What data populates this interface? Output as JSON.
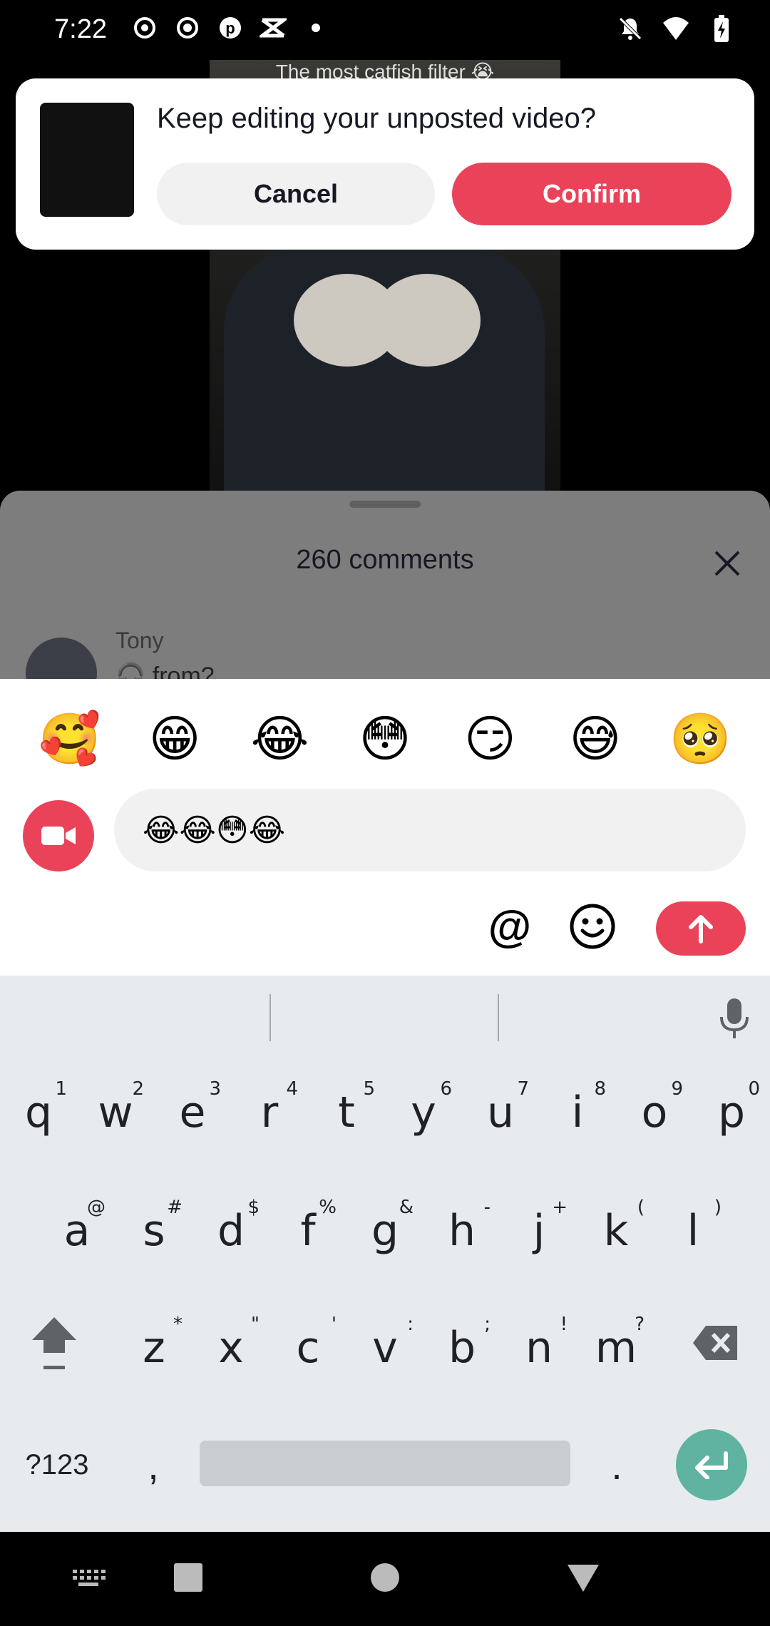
{
  "status_bar": {
    "time": "7:22"
  },
  "video": {
    "caption": "The most catfish filter 😭"
  },
  "dialog": {
    "title": "Keep editing your unposted video?",
    "cancel_label": "Cancel",
    "confirm_label": "Confirm",
    "confirm_color": "#ea4359"
  },
  "comments": {
    "title": "260 comments",
    "first_comment": {
      "user": "Tony",
      "text": "🎧 from?"
    }
  },
  "composer": {
    "quick_emojis": [
      "🥰",
      "😁",
      "😂",
      "😳",
      "😏",
      "😅",
      "🥺"
    ],
    "input_value": "😂😂😳😂",
    "at_label": "@"
  },
  "keyboard": {
    "row1": [
      {
        "k": "q",
        "h": "1"
      },
      {
        "k": "w",
        "h": "2"
      },
      {
        "k": "e",
        "h": "3"
      },
      {
        "k": "r",
        "h": "4"
      },
      {
        "k": "t",
        "h": "5"
      },
      {
        "k": "y",
        "h": "6"
      },
      {
        "k": "u",
        "h": "7"
      },
      {
        "k": "i",
        "h": "8"
      },
      {
        "k": "o",
        "h": "9"
      },
      {
        "k": "p",
        "h": "0"
      }
    ],
    "row2": [
      {
        "k": "a",
        "h": "@"
      },
      {
        "k": "s",
        "h": "#"
      },
      {
        "k": "d",
        "h": "$"
      },
      {
        "k": "f",
        "h": "%"
      },
      {
        "k": "g",
        "h": "&"
      },
      {
        "k": "h",
        "h": "-"
      },
      {
        "k": "j",
        "h": "+"
      },
      {
        "k": "k",
        "h": "("
      },
      {
        "k": "l",
        "h": ")"
      }
    ],
    "row3": [
      {
        "k": "z",
        "h": "*"
      },
      {
        "k": "x",
        "h": "\""
      },
      {
        "k": "c",
        "h": "'"
      },
      {
        "k": "v",
        "h": ":"
      },
      {
        "k": "b",
        "h": ";"
      },
      {
        "k": "n",
        "h": "!"
      },
      {
        "k": "m",
        "h": "?"
      }
    ],
    "symbols_label": "?123",
    "comma_label": ",",
    "period_label": ".",
    "enter_color": "#5fb3a0"
  }
}
